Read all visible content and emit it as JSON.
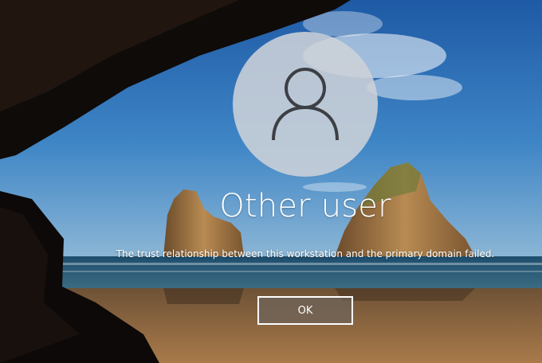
{
  "user": {
    "name": "Other user",
    "avatar_icon": "user-silhouette-icon"
  },
  "message": {
    "text": "The trust relationship between this workstation and the primary domain failed."
  },
  "actions": {
    "ok_label": "OK"
  },
  "colors": {
    "avatar_bg": "#cdd2d8",
    "avatar_glyph": "#3c3f44",
    "text": "#ffffff",
    "button_border": "#ffffff"
  }
}
